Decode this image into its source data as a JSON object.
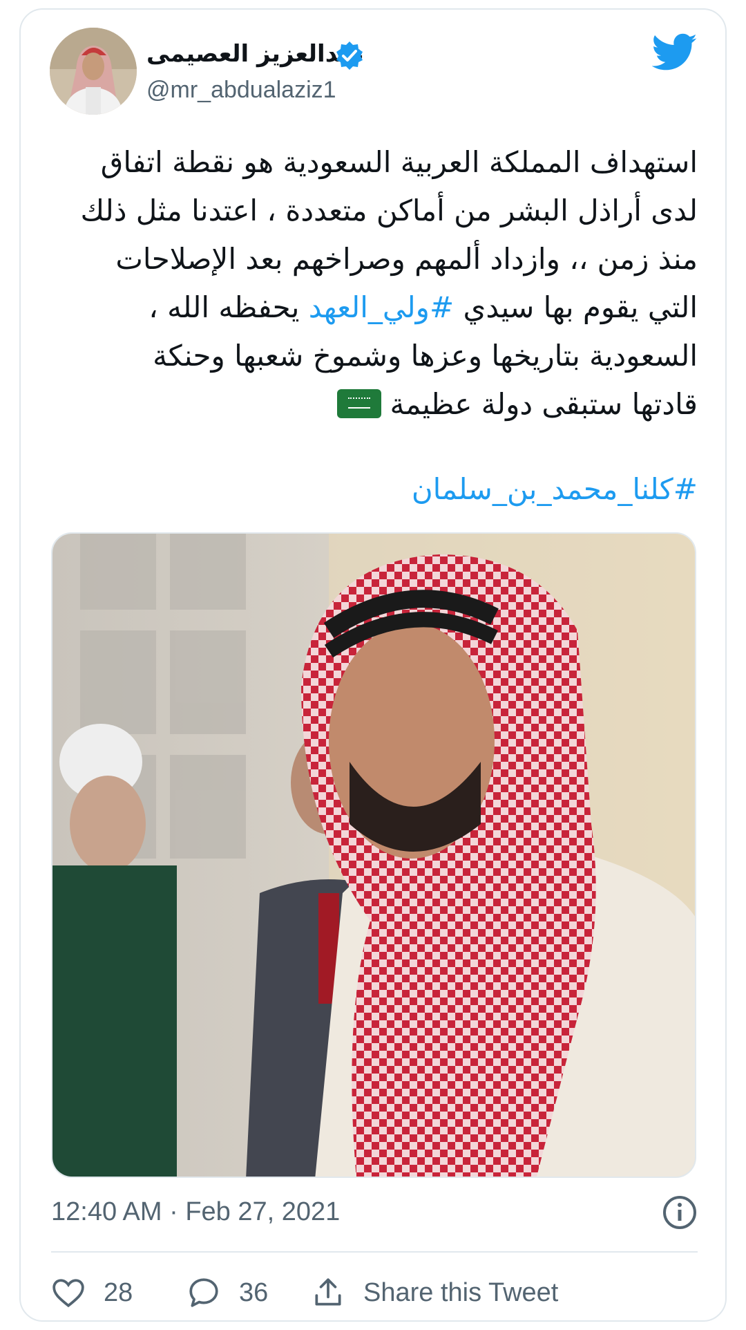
{
  "user": {
    "display_name": "عبدالعزيز العصيمى",
    "handle": "@mr_abdualaziz1",
    "verified": true,
    "avatar": "user-avatar-photo"
  },
  "brand": {
    "logo_icon": "twitter-bird-icon",
    "accent_color": "#1d9bf0"
  },
  "tweet": {
    "line1": "استهداف المملكة العربية السعودية هو نقطة اتفاق",
    "line2": "لدى أراذل البشر من أماكن متعددة ، اعتدنا مثل ذلك",
    "line3": "منذ زمن ،، وازداد ألمهم وصراخهم بعد الإصلاحات",
    "line4_before": "التي يقوم بها سيدي ",
    "line4_hashtag": "#ولي_العهد",
    "line4_after": " يحفظه الله ،",
    "line5": "السعودية بتاريخها وعزها وشموخ شعبها وحنكة",
    "line6": "قادتها ستبقى دولة عظيمة",
    "emoji": "saudi-flag-emoji",
    "hashtag_line": "#كلنا_محمد_بن_سلمان",
    "media": "photo-man-in-red-white-shemagh",
    "timestamp": "12:40 AM · Feb 27, 2021"
  },
  "actions": {
    "likes_count": "28",
    "replies_count": "36",
    "share_label": "Share this Tweet",
    "like_icon": "heart-icon",
    "reply_icon": "speech-bubble-icon",
    "share_icon": "share-upload-icon",
    "info_icon": "info-icon"
  }
}
